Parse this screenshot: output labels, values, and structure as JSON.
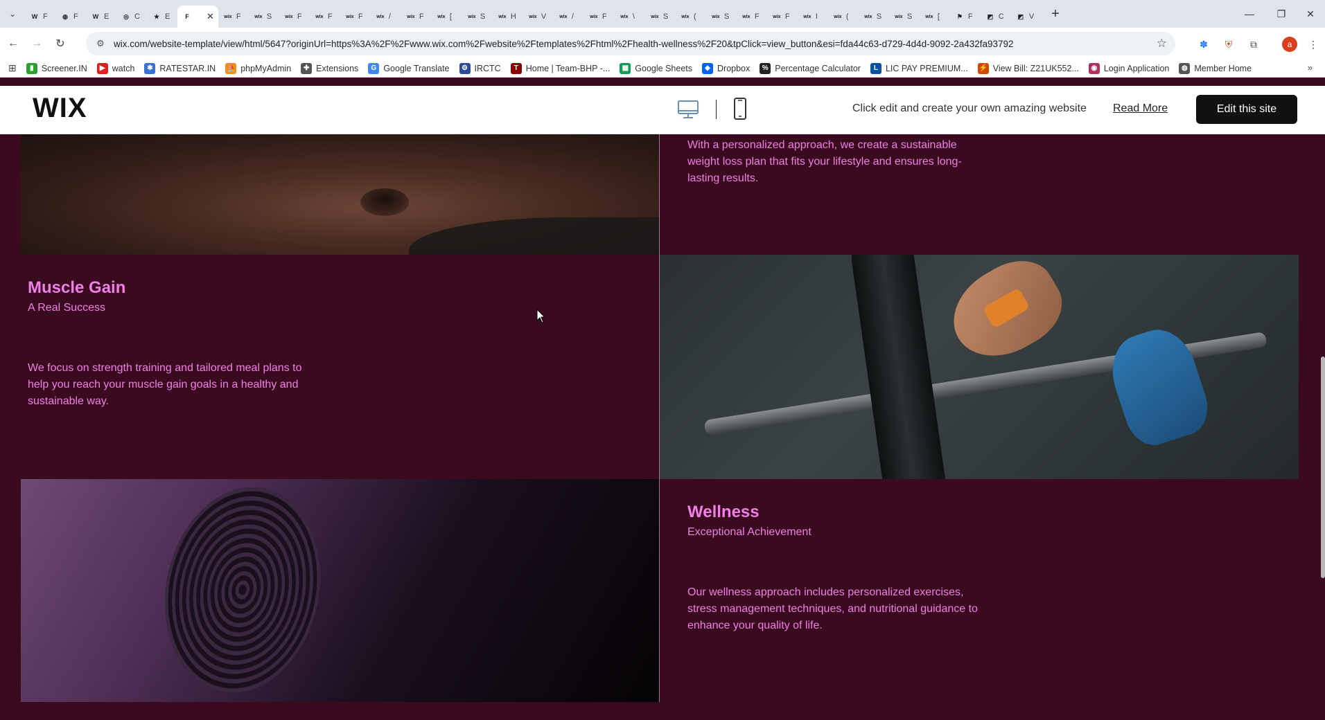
{
  "browser": {
    "tabs": [
      {
        "icon": "W",
        "label": "F",
        "color": "#ffffff"
      },
      {
        "icon": "◍",
        "label": "F",
        "color": "#cfe2ff"
      },
      {
        "icon": "W",
        "label": "E",
        "color": "#ffffff"
      },
      {
        "icon": "◎",
        "label": "C",
        "color": "#ffffff"
      },
      {
        "icon": "★",
        "label": "E",
        "color": "#ffffff"
      },
      {
        "icon": "F",
        "label": "",
        "color": "#ffffff",
        "active": true
      },
      {
        "icon": "wix",
        "label": "F"
      },
      {
        "icon": "wix",
        "label": "S"
      },
      {
        "icon": "wix",
        "label": "F"
      },
      {
        "icon": "wix",
        "label": "F"
      },
      {
        "icon": "wix",
        "label": "F"
      },
      {
        "icon": "wix",
        "label": "/"
      },
      {
        "icon": "wix",
        "label": "F"
      },
      {
        "icon": "wix",
        "label": "["
      },
      {
        "icon": "wix",
        "label": "S"
      },
      {
        "icon": "wix",
        "label": "H"
      },
      {
        "icon": "wix",
        "label": "V"
      },
      {
        "icon": "wix",
        "label": "/"
      },
      {
        "icon": "wix",
        "label": "F"
      },
      {
        "icon": "wix",
        "label": "\\"
      },
      {
        "icon": "wix",
        "label": "S"
      },
      {
        "icon": "wix",
        "label": "("
      },
      {
        "icon": "wix",
        "label": "S"
      },
      {
        "icon": "wix",
        "label": "F"
      },
      {
        "icon": "wix",
        "label": "F"
      },
      {
        "icon": "wix",
        "label": "I"
      },
      {
        "icon": "wix",
        "label": "("
      },
      {
        "icon": "wix",
        "label": "S"
      },
      {
        "icon": "wix",
        "label": "S"
      },
      {
        "icon": "wix",
        "label": "["
      },
      {
        "icon": "⚑",
        "label": "F"
      },
      {
        "icon": "◩",
        "label": "C"
      },
      {
        "icon": "◩",
        "label": "V"
      }
    ],
    "url": "wix.com/website-template/view/html/5647?originUrl=https%3A%2F%2Fwww.wix.com%2Fwebsite%2Ftemplates%2Fhtml%2Fhealth-wellness%2F20&tpClick=view_button&esi=fda44c63-d729-4d4d-9092-2a432fa93792",
    "profile_initial": "a",
    "bookmarks": [
      {
        "label": "Screener.IN",
        "icon_color": "#2ca02c",
        "icon": "▮"
      },
      {
        "label": "watch",
        "icon_color": "#e02020",
        "icon": "▶"
      },
      {
        "label": "RATESTAR.IN",
        "icon_color": "#3b6fd1",
        "icon": "✱"
      },
      {
        "label": "phpMyAdmin",
        "icon_color": "#f29111",
        "icon": "⛵"
      },
      {
        "label": "Extensions",
        "icon_color": "#555555",
        "icon": "✚"
      },
      {
        "label": "Google Translate",
        "icon_color": "#4285f4",
        "icon": "G"
      },
      {
        "label": "IRCTC",
        "icon_color": "#2a4d9b",
        "icon": "⚙"
      },
      {
        "label": "Home | Team-BHP -...",
        "icon_color": "#8b0000",
        "icon": "T"
      },
      {
        "label": "Google Sheets",
        "icon_color": "#0f9d58",
        "icon": "▦"
      },
      {
        "label": "Dropbox",
        "icon_color": "#0061ff",
        "icon": "◆"
      },
      {
        "label": "Percentage Calculator",
        "icon_color": "#222222",
        "icon": "%"
      },
      {
        "label": "LIC PAY PREMIUM...",
        "icon_color": "#0b4f9f",
        "icon": "L"
      },
      {
        "label": "View Bill: Z21UK552...",
        "icon_color": "#d04a02",
        "icon": "⚡"
      },
      {
        "label": "Login Application",
        "icon_color": "#b03060",
        "icon": "◉"
      },
      {
        "label": "Member Home",
        "icon_color": "#555555",
        "icon": "◍"
      }
    ]
  },
  "wix_bar": {
    "logo": "WIX",
    "cta_text": "Click edit and create your own amazing website",
    "read_more": "Read More",
    "edit_button": "Edit this site"
  },
  "sections": {
    "weight_loss": {
      "body": "With a personalized approach, we create a sustainable weight loss plan that fits your lifestyle and ensures long-lasting results."
    },
    "muscle_gain": {
      "title": "Muscle Gain",
      "subtitle": "A Real Success",
      "body": "We focus on strength training and tailored meal plans to help you reach your muscle gain goals in a healthy and sustainable way."
    },
    "wellness": {
      "title": "Wellness",
      "subtitle": "Exceptional Achievement",
      "body": "Our wellness approach includes personalized exercises, stress management techniques, and nutritional guidance to enhance your quality of life."
    }
  },
  "colors": {
    "page_bg": "#3a0a1e",
    "accent_text": "#f07fe8"
  }
}
